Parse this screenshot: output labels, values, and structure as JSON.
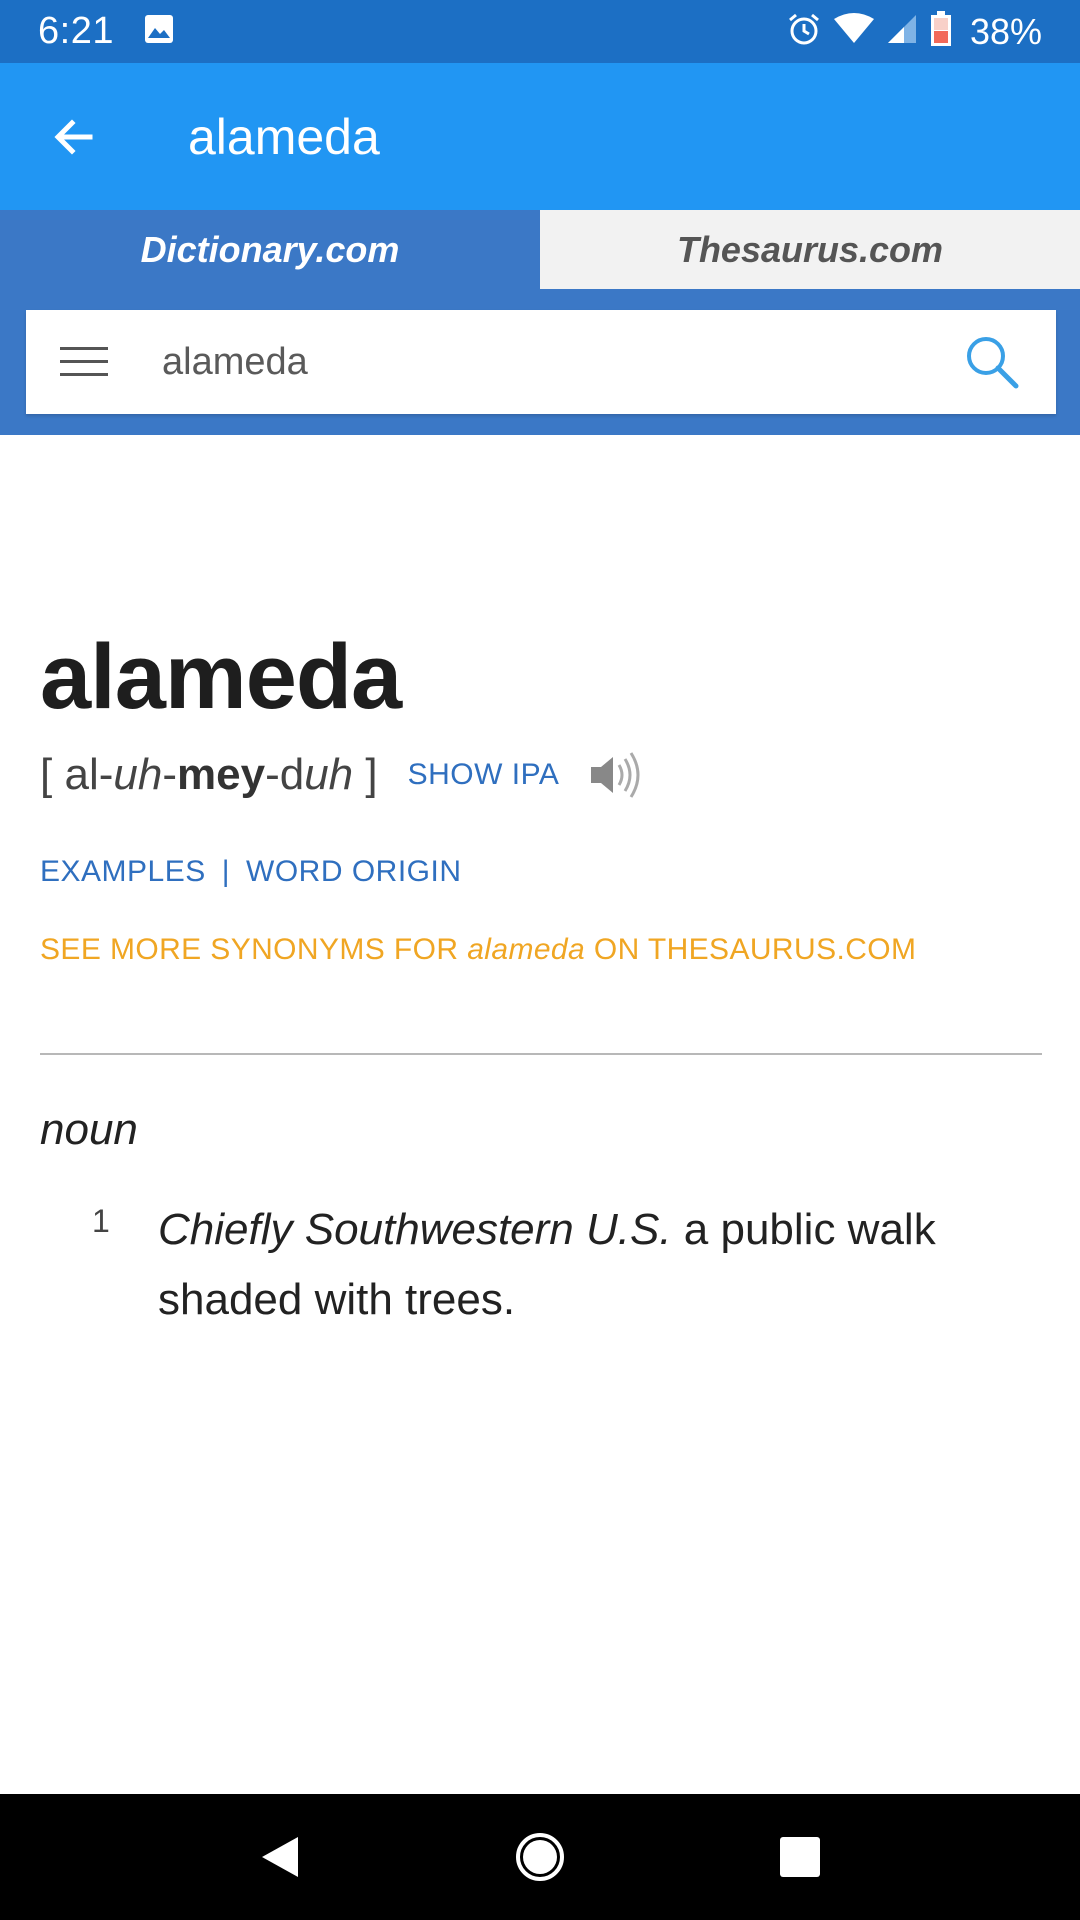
{
  "status_bar": {
    "time": "6:21",
    "battery_percent": "38%",
    "icons": [
      "image-icon",
      "alarm-icon",
      "wifi-icon",
      "signal-icon",
      "battery-icon"
    ]
  },
  "app_bar": {
    "title": "alameda",
    "back_icon": "arrow-back-icon"
  },
  "tabs": [
    {
      "label": "Dictionary.com",
      "active": true
    },
    {
      "label": "Thesaurus.com",
      "active": false
    }
  ],
  "search": {
    "value": "alameda",
    "placeholder": "",
    "menu_icon": "hamburger-menu-icon",
    "search_icon": "magnifier-icon"
  },
  "entry": {
    "headword": "alameda",
    "pron_open": "[",
    "pron_parts": [
      "al-",
      "uh",
      "-",
      "mey",
      "-d",
      "uh"
    ],
    "pron_close": "]",
    "show_ipa": "SHOW IPA",
    "speaker_icon": "speaker-icon",
    "links": [
      "EXAMPLES",
      "|",
      "WORD ORIGIN"
    ],
    "synonyms_prefix": "SEE MORE SYNONYMS FOR",
    "synonyms_word": "alameda",
    "synonyms_suffix": "ON THESAURUS.COM",
    "part_of_speech": "noun",
    "senses": [
      {
        "number": "1",
        "label": "Chiefly Southwestern U.S.",
        "text": "a public walk shaded with trees."
      }
    ]
  },
  "nav_bar": {
    "buttons": [
      "back-triangle-icon",
      "home-circle-icon",
      "recents-square-icon"
    ]
  },
  "colors": {
    "status_bar": "#1c6fc4",
    "app_bar": "#2196f3",
    "tab_bar": "#3b78c6",
    "link_blue": "#2f6fbf",
    "synonym_orange": "#f0a623"
  }
}
